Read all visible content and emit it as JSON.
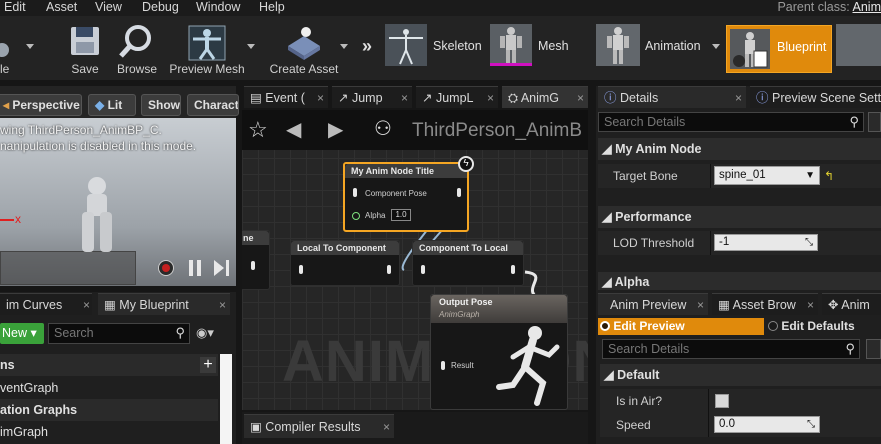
{
  "menu": {
    "items": [
      "Edit",
      "Asset",
      "View",
      "Debug",
      "Window",
      "Help"
    ],
    "parent_class_label": "Parent class:",
    "parent_class_value": "Anim"
  },
  "toolbar": {
    "left_cut_label": "le",
    "save": "Save",
    "browse": "Browse",
    "preview_mesh": "Preview Mesh",
    "create_asset": "Create Asset",
    "modes": {
      "skeleton": "Skeleton",
      "mesh": "Mesh",
      "animation": "Animation",
      "blueprint": "Blueprint"
    }
  },
  "viewport": {
    "perspective": "Perspective",
    "lit": "Lit",
    "show": "Show",
    "character": "Charact",
    "overlay_line1": "wing ThirdPerson_AnimBP_C.",
    "overlay_line2": "nanipulation is disabled in this mode.",
    "axis_x": "x"
  },
  "graph_tabs": [
    "Event (",
    "Jump",
    "JumpL",
    "AnimG"
  ],
  "graph": {
    "title": "ThirdPerson_AnimB",
    "watermark": "ANIMATION",
    "cut_node": "ne",
    "my_node_title": "My Anim Node Title",
    "my_node_pin": "Component Pose",
    "my_node_alpha_label": "Alpha",
    "my_node_alpha_value": "1.0",
    "local_to_component": "Local To Component",
    "component_to_local": "Component To Local",
    "output_pose": "Output Pose",
    "output_sub": "AnimGraph",
    "output_pin": "Result"
  },
  "compiler_tab": "Compiler Results",
  "blueprint_panel": {
    "tab_anim_curves": "im Curves",
    "tab_my_blueprint": "My Blueprint",
    "new_button": "New",
    "search_placeholder": "Search",
    "items": [
      "ns",
      "ventGraph",
      "ation Graphs",
      "imGraph"
    ]
  },
  "details": {
    "tab": "Details",
    "tab2": "Preview Scene Sett",
    "search_placeholder": "Search Details",
    "section_my_anim_node": "My Anim Node",
    "target_bone_label": "Target Bone",
    "target_bone_value": "spine_01",
    "section_performance": "Performance",
    "lod_label": "LOD Threshold",
    "lod_value": "-1",
    "section_alpha": "Alpha"
  },
  "anim_preview": {
    "tab1": "Anim Preview",
    "tab2": "Asset Brow",
    "tab3": "Anim",
    "edit_preview": "Edit Preview",
    "edit_defaults": "Edit Defaults",
    "search_placeholder": "Search Details",
    "section_default": "Default",
    "is_in_air_label": "Is in Air?",
    "speed_label": "Speed",
    "speed_value": "0.0"
  },
  "colors": {
    "accent": "#e08a0c",
    "node_highlight": "#f5a623",
    "exec_green": "#3aa23a",
    "record_red": "#c42020"
  }
}
